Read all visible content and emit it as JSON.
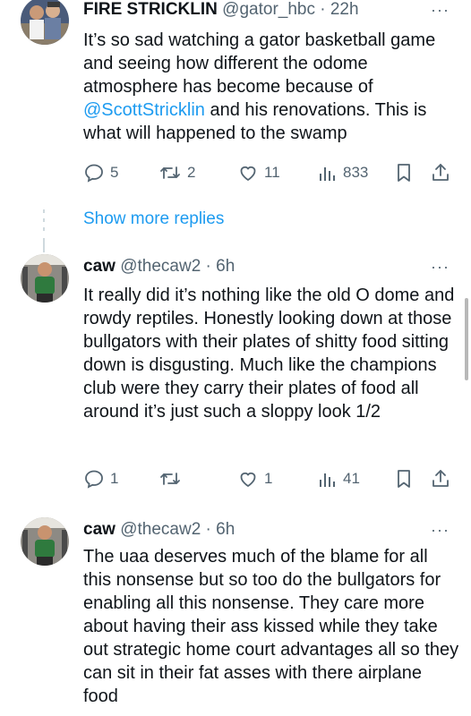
{
  "tweets": [
    {
      "display_name": "FIRE STRICKLIN",
      "handle": "@gator_hbc",
      "separator": "·",
      "time": "22h",
      "more": "···",
      "text_before": "It’s so sad watching a gator basketball game and seeing how different the odome atmosphere has become because of ",
      "mention": "@ScottStricklin",
      "text_after": " and his renovations. This is what will happened to the swamp",
      "replies": "5",
      "retweets": "2",
      "likes": "11",
      "views": "833"
    },
    {
      "display_name": "caw",
      "handle": "@thecaw2",
      "separator": "·",
      "time": "6h",
      "more": "···",
      "text": "It really did it’s nothing like the old O dome and rowdy reptiles. Honestly looking down at those bullgators with their plates of shitty food sitting down is disgusting. Much like the champions club were they carry their plates of food all around it’s just such a sloppy look 1/2",
      "replies": "1",
      "retweets": "",
      "likes": "1",
      "views": "41"
    },
    {
      "display_name": "caw",
      "handle": "@thecaw2",
      "separator": "·",
      "time": "6h",
      "more": "···",
      "text": "The uaa deserves much of the blame for all this nonsense but so too do the bullgators for enabling all this nonsense. They care more about having their ass kissed while they take out strategic home court advantages all so they can sit in their fat asses with there airplane food"
    }
  ],
  "show_more_replies": "Show more replies",
  "icons": [
    "reply-icon",
    "retweet-icon",
    "like-icon",
    "views-icon",
    "bookmark-icon",
    "share-icon",
    "more-icon"
  ],
  "colors": {
    "text": "#0f1419",
    "secondary": "#536471",
    "link": "#1d9bf0",
    "line": "#cfd9de"
  }
}
